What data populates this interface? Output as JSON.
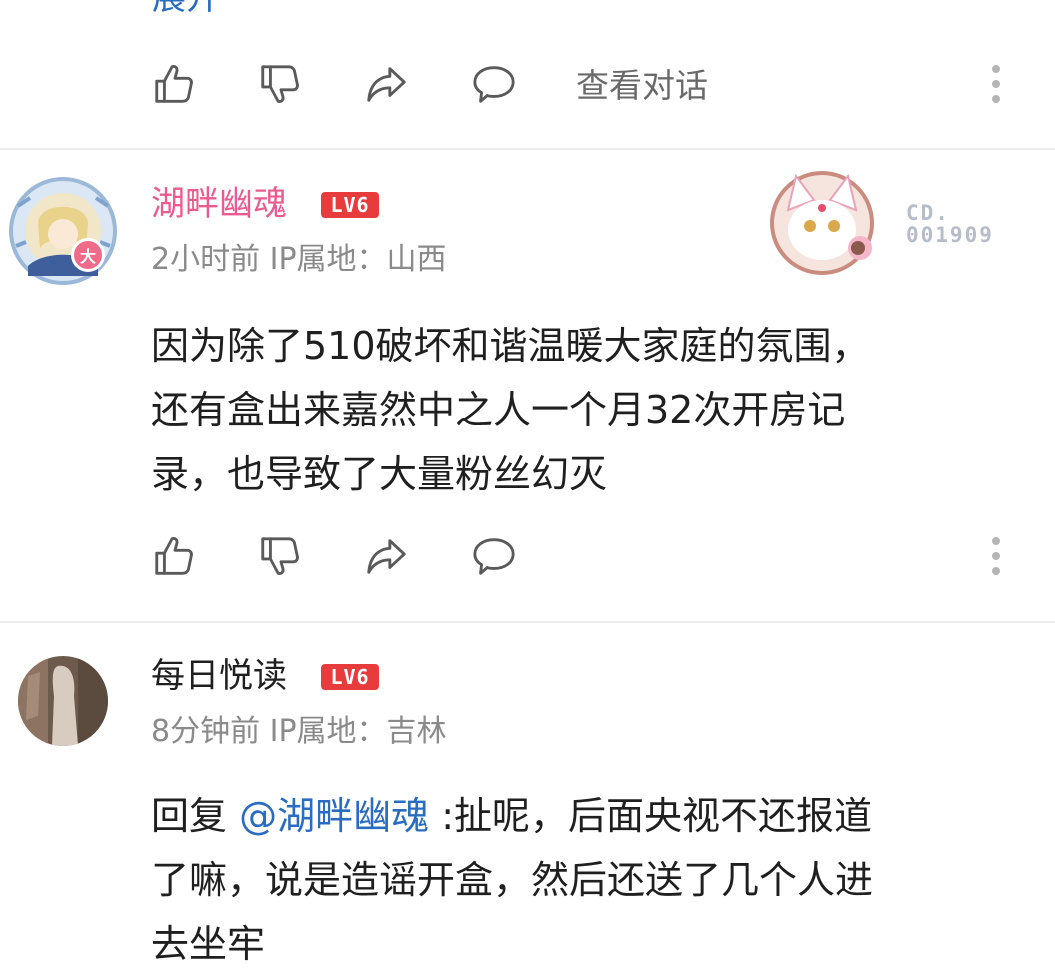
{
  "colors": {
    "username_pink": "#ea5b8e",
    "link_blue": "#2a6cc0",
    "level_badge_red": "#e83b3b",
    "meta_gray": "#8a8a8a"
  },
  "top_item": {
    "expand_link": "展开",
    "view_dialog_label": "查看对话"
  },
  "comments": [
    {
      "username": "湖畔幽魂",
      "level": "LV6",
      "avatar_badge": "大",
      "meta": "2小时前 IP属地：山西",
      "card_code_line1": "CD.",
      "card_code_line2": "001909",
      "content_lines": [
        "因为除了510破坏和谐温暖大家庭的氛围，",
        "还有盒出来嘉然中之人一个月32次开房记",
        "录，也导致了大量粉丝幻灭"
      ]
    },
    {
      "username": "每日悦读",
      "level": "LV6",
      "meta": "8分钟前 IP属地：吉林",
      "reply_prefix": "回复 ",
      "mention": "@湖畔幽魂",
      "content_first_rest": " :扯呢，后面央视不还报道",
      "content_lines": [
        "了嘛，说是造谣开盒，然后还送了几个人进",
        "去坐牢"
      ]
    }
  ],
  "icons": {
    "like": "thumbs-up-icon",
    "dislike": "thumbs-down-icon",
    "share": "share-arrow-icon",
    "comment": "comment-bubble-icon",
    "more": "more-vertical-icon"
  }
}
